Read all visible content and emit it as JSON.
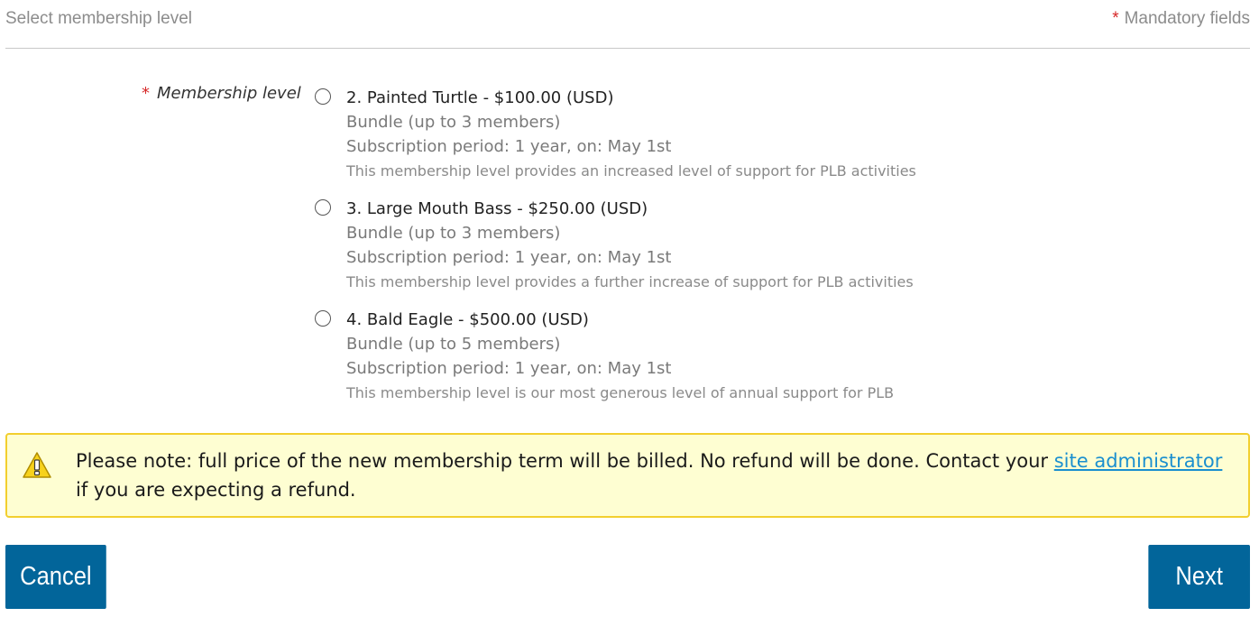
{
  "header": {
    "title": "Select membership level",
    "mandatory_star": "*",
    "mandatory_label": "Mandatory fields"
  },
  "membership_field": {
    "required_star": "*",
    "label": "Membership level",
    "options": [
      {
        "title": "2. Painted Turtle - $100.00 (USD)",
        "bundle": "Bundle (up to 3 members)",
        "subscription": "Subscription period: 1 year, on: May 1st",
        "description": "This membership level provides an increased level of support for PLB activities",
        "selected": false
      },
      {
        "title": "3. Large Mouth Bass - $250.00 (USD)",
        "bundle": "Bundle (up to 3 members)",
        "subscription": "Subscription period: 1 year, on: May 1st",
        "description": "This membership level provides a further increase of support for PLB activities",
        "selected": false
      },
      {
        "title": "4. Bald Eagle - $500.00 (USD)",
        "bundle": "Bundle (up to 5 members)",
        "subscription": "Subscription period: 1 year, on: May 1st",
        "description": "This membership level is our most generous level of annual support for PLB",
        "selected": false
      }
    ]
  },
  "notice": {
    "icon": "warning-icon",
    "text_before": "Please note: full price of the new membership term will be billed. No refund will be done. Contact your ",
    "link_text": "site administrator",
    "text_after": " if you are expecting a refund."
  },
  "buttons": {
    "cancel_label": "Cancel",
    "next_label": "Next"
  },
  "colors": {
    "button_bg": "#02659a",
    "notice_bg": "#fefed2",
    "notice_border": "#f2cf2e",
    "link": "#1a8fcf",
    "required": "#d62828"
  }
}
